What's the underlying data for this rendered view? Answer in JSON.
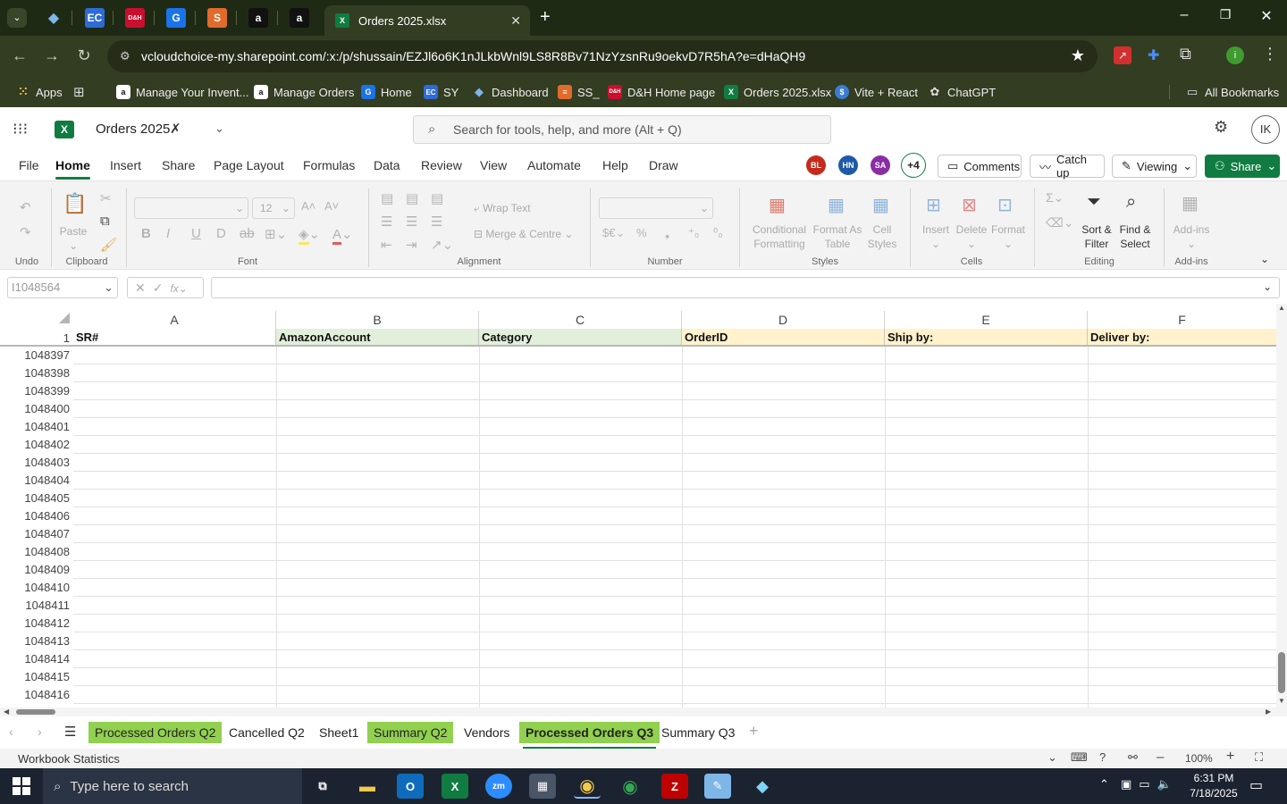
{
  "browser": {
    "active_tab_title": "Orders 2025.xlsx",
    "url": "vcloudchoice-my.sharepoint.com/:x:/p/shussain/EZJl6o6K1nJLkbWnl9LS8R8Bv71NzYzsnRu9oekvD7R5hA?e=dHaQH9",
    "tab_icons": [
      {
        "label": "EC",
        "color": "#2d6bd6"
      },
      {
        "label": "D&H",
        "color": "#c8102e"
      },
      {
        "label": "G",
        "color": "#1a73e8"
      },
      {
        "label": "S",
        "color": "#e06b2b"
      },
      {
        "label": "a",
        "color": "#111111"
      },
      {
        "label": "a",
        "color": "#111111"
      }
    ],
    "bookmarks": [
      {
        "label": "Apps",
        "icon": "apps-grid-icon"
      },
      {
        "label": "Manage Your Invent...",
        "icon": "amazon-icon"
      },
      {
        "label": "Manage Orders",
        "icon": "amazon-icon"
      },
      {
        "label": "Home",
        "icon": "google-icon"
      },
      {
        "label": "SY",
        "icon": "ec-icon"
      },
      {
        "label": "Dashboard",
        "icon": "diamond-icon"
      },
      {
        "label": "SS_",
        "icon": "stack-icon"
      },
      {
        "label": "D&H Home page",
        "icon": "dh-icon"
      },
      {
        "label": "Orders 2025.xlsx",
        "icon": "excel-icon"
      },
      {
        "label": "Vite + React",
        "icon": "dollar-icon"
      },
      {
        "label": "ChatGPT",
        "icon": "chatgpt-icon"
      }
    ],
    "all_bookmarks": "All Bookmarks"
  },
  "excel": {
    "doc_title": "Orders 2025",
    "search_placeholder": "Search for tools, help, and more (Alt + Q)",
    "user_initials": "IK",
    "menu": [
      "File",
      "Home",
      "Insert",
      "Share",
      "Page Layout",
      "Formulas",
      "Data",
      "Review",
      "View",
      "Automate",
      "Help",
      "Draw"
    ],
    "collaborators": [
      {
        "initials": "BL",
        "color": "#c42b1c"
      },
      {
        "initials": "HN",
        "color": "#1e5aa8"
      },
      {
        "initials": "SA",
        "color": "#8a2da5"
      }
    ],
    "collab_more": "+4",
    "comments_label": "Comments",
    "catchup_label": "Catch up",
    "viewing_label": "Viewing",
    "share_label": "Share",
    "ribbon": {
      "undo_label": "Undo",
      "clipboard_label": "Clipboard",
      "paste_label": "Paste",
      "font_label": "Font",
      "font_size": "12",
      "alignment_label": "Alignment",
      "wrap_text": "Wrap Text",
      "merge_centre": "Merge & Centre",
      "number_label": "Number",
      "styles_label": "Styles",
      "conditional_formatting": "Conditional Formatting",
      "format_as_table": "Format As Table",
      "cell_styles": "Cell Styles",
      "cells_label": "Cells",
      "insert": "Insert",
      "delete": "Delete",
      "format": "Format",
      "editing_label": "Editing",
      "sort_filter": "Sort & Filter",
      "find_select": "Find & Select",
      "addins": "Add-ins",
      "addins_label": "Add-ins"
    },
    "name_box": "I1048564",
    "columns": [
      "A",
      "B",
      "C",
      "D",
      "E",
      "F"
    ],
    "header_row_number": "1",
    "header_cells": [
      {
        "text": "SR#",
        "bg": "#ffffff"
      },
      {
        "text": "AmazonAccount",
        "bg": "#e2efda"
      },
      {
        "text": "Category",
        "bg": "#e2efda"
      },
      {
        "text": "OrderID",
        "bg": "#fff2cc"
      },
      {
        "text": "Ship by:",
        "bg": "#fff2cc"
      },
      {
        "text": "Deliver by:",
        "bg": "#fff2cc"
      }
    ],
    "row_numbers": [
      "1048397",
      "1048398",
      "1048399",
      "1048400",
      "1048401",
      "1048402",
      "1048403",
      "1048404",
      "1048405",
      "1048406",
      "1048407",
      "1048408",
      "1048409",
      "1048410",
      "1048411",
      "1048412",
      "1048413",
      "1048414",
      "1048415",
      "1048416"
    ],
    "sheets": [
      {
        "name": "Processed Orders Q2",
        "green": true,
        "active": false
      },
      {
        "name": "Cancelled Q2",
        "green": false,
        "active": false
      },
      {
        "name": "Sheet1",
        "green": false,
        "active": false
      },
      {
        "name": "Summary Q2",
        "green": true,
        "active": false
      },
      {
        "name": "Vendors",
        "green": false,
        "active": false
      },
      {
        "name": "Processed Orders Q3",
        "green": true,
        "active": true
      },
      {
        "name": "Summary Q3",
        "green": false,
        "active": false
      }
    ],
    "status_left": "Workbook Statistics",
    "zoom": "100%"
  },
  "taskbar": {
    "search_placeholder": "Type here to search",
    "time": "6:31 PM",
    "date": "7/18/2025"
  }
}
